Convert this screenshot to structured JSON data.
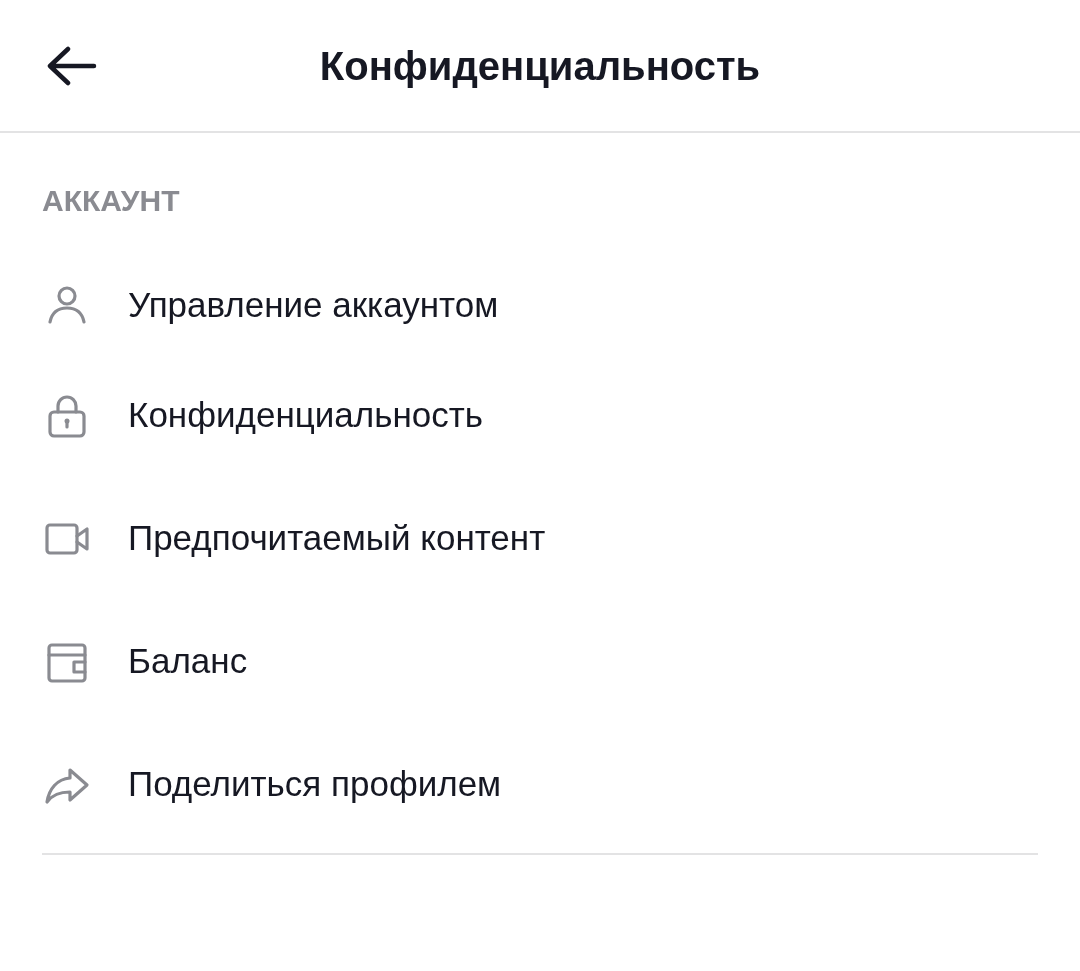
{
  "header": {
    "title": "Конфиденциальность"
  },
  "section": {
    "heading": "АККАУНТ",
    "items": [
      {
        "label": "Управление аккаунтом",
        "kind": "person"
      },
      {
        "label": "Конфиденциальность",
        "kind": "lock"
      },
      {
        "label": "Предпочитаемый контент",
        "kind": "video"
      },
      {
        "label": "Баланс",
        "kind": "wallet"
      },
      {
        "label": "Поделиться профилем",
        "kind": "share"
      }
    ]
  }
}
